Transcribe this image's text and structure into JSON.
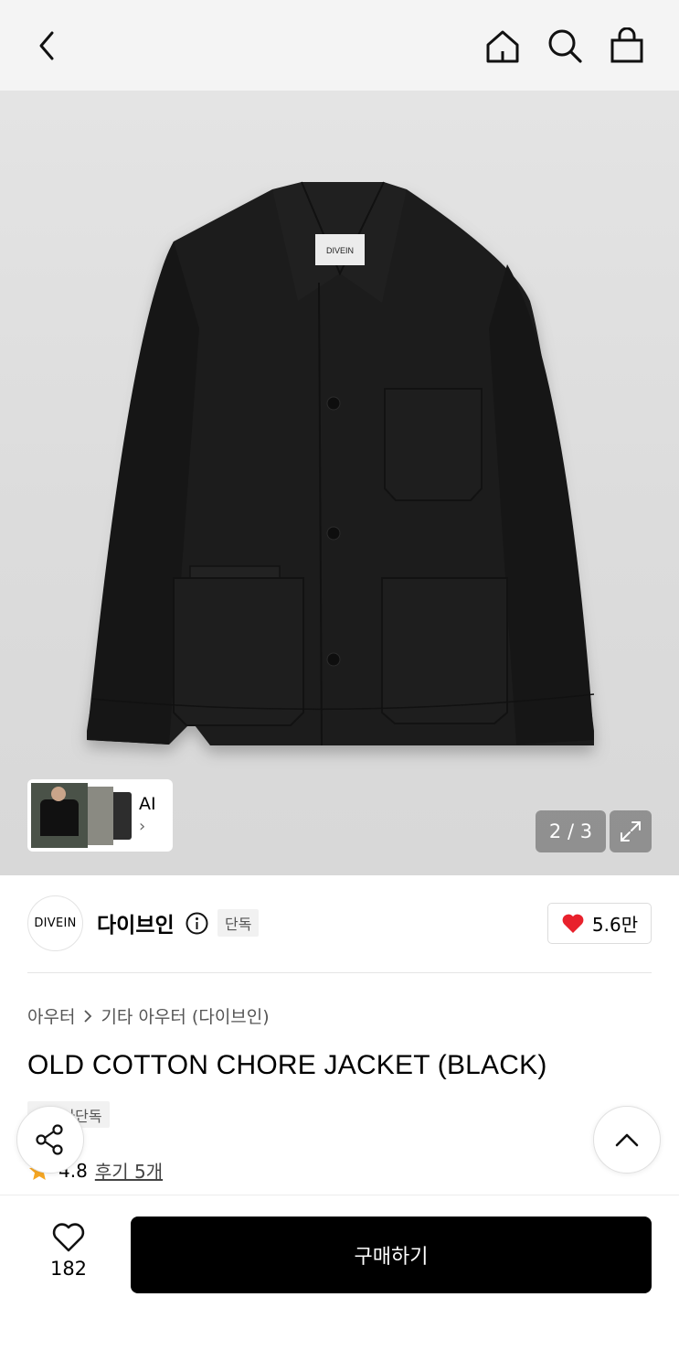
{
  "header": {
    "back_icon": "chevron-left-icon",
    "home_icon": "home-icon",
    "search_icon": "search-icon",
    "cart_icon": "shopping-bag-icon"
  },
  "hero": {
    "label_text": "DIVEIN",
    "thumbnail_label": "AI",
    "thumbnail_chevron": "›",
    "pager": "2 / 3",
    "expand_icon": "expand-icon"
  },
  "brand": {
    "logo_text": "DIVEIN",
    "name": "다이브인",
    "badge": "단독",
    "likes": "5.6만",
    "like_color": "#e8212c"
  },
  "product": {
    "breadcrumb": [
      "아우터",
      "기타 아우터 (다이브인)"
    ],
    "title": "OLD COTTON CHORE JACKET (BLACK)",
    "exclusive_tag": "무신사단독",
    "rating": "4.8",
    "reviews": "후기 5개",
    "star_color": "#f5a623"
  },
  "bottom": {
    "wish_count": "182",
    "buy_label": "구매하기"
  }
}
